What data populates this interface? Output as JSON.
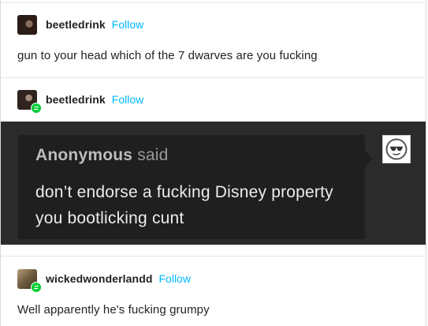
{
  "posts": [
    {
      "username": "beetledrink",
      "follow_label": "Follow",
      "body": "gun to your head which of the 7 dwarves are you fucking",
      "reblog": false
    },
    {
      "username": "beetledrink",
      "follow_label": "Follow",
      "reblog": true,
      "ask": {
        "asker_name": "Anonymous",
        "said_label": "said",
        "question": "don’t endorse a fucking Disney property you bootlicking cunt",
        "avatar_icon": "anonymous-sunglasses-icon"
      }
    },
    {
      "username": "wickedwonderlandd",
      "follow_label": "Follow",
      "body": "Well apparently he's fucking grumpy",
      "reblog": true
    }
  ],
  "colors": {
    "follow": "#00b8ff",
    "reblog_badge": "#00cf35",
    "ask_panel_bg": "#2b2b2b",
    "ask_bubble_bg": "#1f1f1f"
  }
}
